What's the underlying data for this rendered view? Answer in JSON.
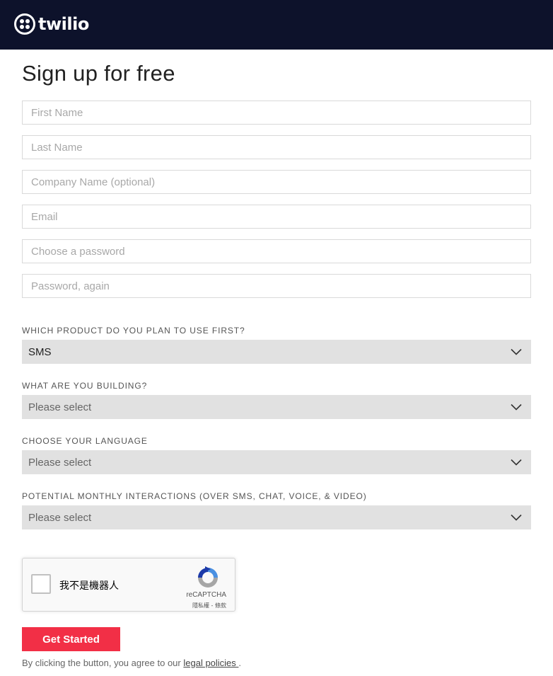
{
  "header": {
    "logo_text": "twilio",
    "bg_color": "#0d122b"
  },
  "form": {
    "title": "Sign up for free",
    "fields": {
      "first_name": {
        "placeholder": "First Name",
        "value": ""
      },
      "last_name": {
        "placeholder": "Last Name",
        "value": ""
      },
      "company_name": {
        "placeholder": "Company Name (optional)",
        "value": ""
      },
      "email": {
        "placeholder": "Email",
        "value": ""
      },
      "password": {
        "placeholder": "Choose a password",
        "value": ""
      },
      "password_again": {
        "placeholder": "Password, again",
        "value": ""
      }
    },
    "selects": {
      "product": {
        "label": "WHICH PRODUCT DO YOU PLAN TO USE FIRST?",
        "value": "SMS"
      },
      "building": {
        "label": "WHAT ARE YOU BUILDING?",
        "value": "Please select"
      },
      "language": {
        "label": "CHOOSE YOUR LANGUAGE",
        "value": "Please select"
      },
      "interactions": {
        "label": "POTENTIAL MONTHLY INTERACTIONS (OVER SMS, CHAT, VOICE, & VIDEO)",
        "value": "Please select"
      }
    },
    "recaptcha": {
      "label": "我不是機器人",
      "brand": "reCAPTCHA",
      "terms": "隱私權 - 條款"
    },
    "submit_label": "Get Started",
    "legal": {
      "prefix": "By clicking the button, you agree to our ",
      "link": "legal policies ",
      "suffix": "."
    }
  },
  "colors": {
    "accent": "#f22f46",
    "select_bg": "#e1e1e1"
  },
  "icons": [
    "twilio-logo-icon",
    "chevron-down-icon",
    "recaptcha-icon"
  ]
}
